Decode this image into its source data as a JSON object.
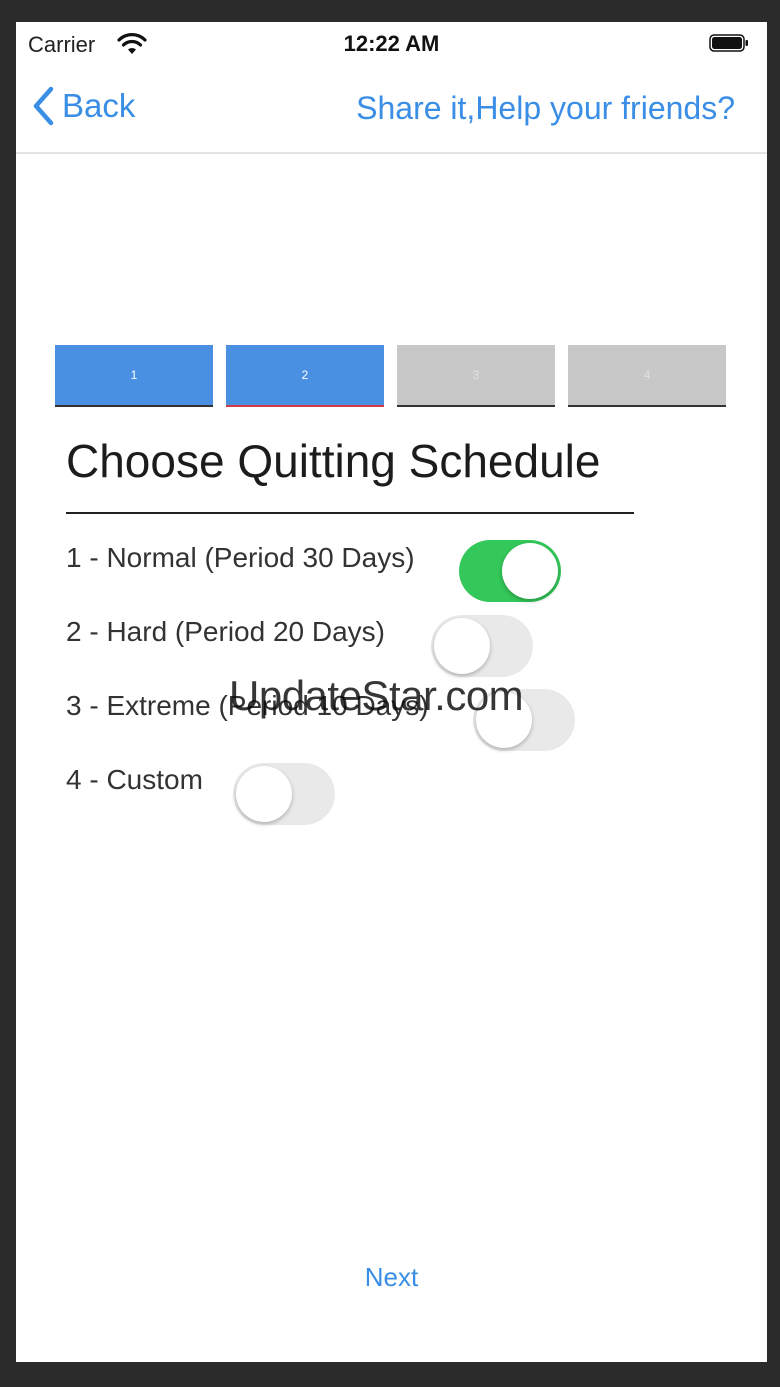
{
  "status_bar": {
    "carrier": "Carrier",
    "time": "12:22 AM",
    "wifi_icon": "wifi-icon",
    "battery_icon": "battery-icon"
  },
  "nav": {
    "back_label": "Back",
    "back_icon": "chevron-left-icon",
    "share_label": "Share it,Help your friends?"
  },
  "steps": [
    {
      "label": "1",
      "state": "completed"
    },
    {
      "label": "2",
      "state": "current"
    },
    {
      "label": "3",
      "state": "pending"
    },
    {
      "label": "4",
      "state": "pending"
    }
  ],
  "heading": "Choose Quitting Schedule",
  "options": [
    {
      "label": "1 - Normal (Period 30 Days)",
      "enabled": true
    },
    {
      "label": "2 - Hard (Period 20 Days)",
      "enabled": false
    },
    {
      "label": "3 - Extreme (Period 10 Days)",
      "enabled": false
    },
    {
      "label": "4 - Custom",
      "enabled": false
    }
  ],
  "watermark": "UpdateStar.com",
  "next_label": "Next",
  "colors": {
    "accent": "#3a8ee6",
    "step_active": "#4a90e2",
    "step_inactive": "#c8c8c8",
    "toggle_on": "#34c759",
    "toggle_off": "#e9e9ea",
    "current_step_underline": "#d23a4a"
  }
}
